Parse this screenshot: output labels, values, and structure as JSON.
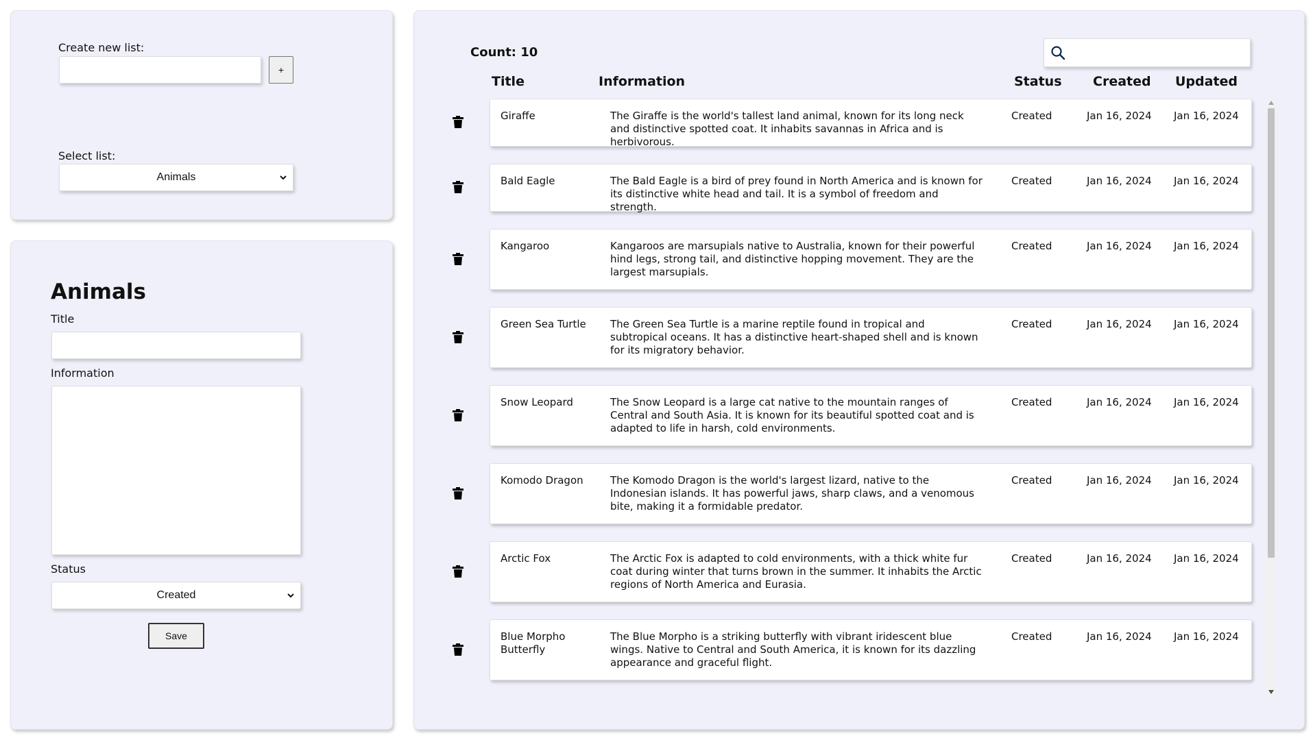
{
  "create_list": {
    "label": "Create new list:",
    "input_value": "",
    "add_label": "+"
  },
  "select_list": {
    "label": "Select list:",
    "selected": "Animals"
  },
  "form": {
    "heading": "Animals",
    "title_label": "Title",
    "title_value": "",
    "information_label": "Information",
    "information_value": "",
    "status_label": "Status",
    "status_selected": "Created",
    "save_label": "Save"
  },
  "table": {
    "count_label": "Count: 10",
    "search_value": "",
    "columns": {
      "title": "Title",
      "information": "Information",
      "status": "Status",
      "created": "Created",
      "updated": "Updated"
    },
    "rows": [
      {
        "title": "Giraffe",
        "information": "The Giraffe is the world's tallest land animal, known for its long neck and distinctive spotted coat. It inhabits savannas in Africa and is herbivorous.",
        "status": "Created",
        "created": "Jan 16, 2024",
        "updated": "Jan 16, 2024"
      },
      {
        "title": "Bald Eagle",
        "information": "The Bald Eagle is a bird of prey found in North America and is known for its distinctive white head and tail. It is a symbol of freedom and strength.",
        "status": "Created",
        "created": "Jan 16, 2024",
        "updated": "Jan 16, 2024"
      },
      {
        "title": "Kangaroo",
        "information": "Kangaroos are marsupials native to Australia, known for their powerful hind legs, strong tail, and distinctive hopping movement. They are the largest marsupials.",
        "status": "Created",
        "created": "Jan 16, 2024",
        "updated": "Jan 16, 2024"
      },
      {
        "title": "Green Sea Turtle",
        "information": "The Green Sea Turtle is a marine reptile found in tropical and subtropical oceans. It has a distinctive heart-shaped shell and is known for its migratory behavior.",
        "status": "Created",
        "created": "Jan 16, 2024",
        "updated": "Jan 16, 2024"
      },
      {
        "title": "Snow Leopard",
        "information": "The Snow Leopard is a large cat native to the mountain ranges of Central and South Asia. It is known for its beautiful spotted coat and is adapted to life in harsh, cold environments.",
        "status": "Created",
        "created": "Jan 16, 2024",
        "updated": "Jan 16, 2024"
      },
      {
        "title": "Komodo Dragon",
        "information": "The Komodo Dragon is the world's largest lizard, native to the Indonesian islands. It has powerful jaws, sharp claws, and a venomous bite, making it a formidable predator.",
        "status": "Created",
        "created": "Jan 16, 2024",
        "updated": "Jan 16, 2024"
      },
      {
        "title": "Arctic Fox",
        "information": "The Arctic Fox is adapted to cold environments, with a thick white fur coat during winter that turns brown in the summer. It inhabits the Arctic regions of North America and Eurasia.",
        "status": "Created",
        "created": "Jan 16, 2024",
        "updated": "Jan 16, 2024"
      },
      {
        "title": "Blue Morpho Butterfly",
        "information": "The Blue Morpho is a striking butterfly with vibrant iridescent blue wings. Native to Central and South America, it is known for its dazzling appearance and graceful flight.",
        "status": "Created",
        "created": "Jan 16, 2024",
        "updated": "Jan 16, 2024"
      }
    ]
  },
  "colors": {
    "panel_bg": "#f0f0fa",
    "card_bg": "#ffffff",
    "search_icon": "#0b2a4a"
  },
  "icons": {
    "delete": "trash-icon",
    "search": "search-icon",
    "dropdown": "chevron-down-icon"
  }
}
